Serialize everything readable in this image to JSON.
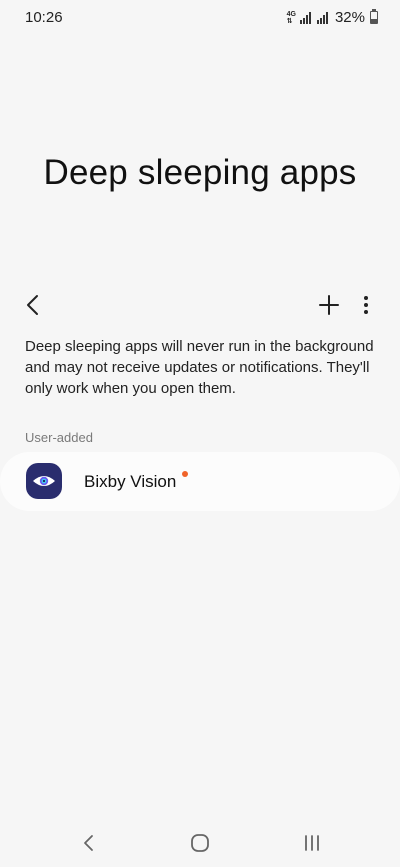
{
  "status_bar": {
    "time": "10:26",
    "network_top": "4G",
    "network_bottom": "⇅",
    "battery_percent": "32%",
    "battery_level": 0.32
  },
  "page": {
    "title": "Deep sleeping apps",
    "description": "Deep sleeping apps will never run in the background and may not receive updates or notifications. They'll only work when you open them."
  },
  "toolbar": {
    "back_icon": "chevron-left-icon",
    "add_icon": "plus-icon",
    "more_icon": "more-vertical-icon"
  },
  "section": {
    "header": "User-added"
  },
  "apps": [
    {
      "name": "Bixby Vision",
      "icon": "bixby-vision-icon",
      "icon_color": "#2a2d6e",
      "has_badge": true,
      "badge_color": "#f0632a"
    }
  ],
  "nav_bar": {
    "back_icon": "nav-back-icon",
    "home_icon": "nav-home-icon",
    "recents_icon": "nav-recents-icon"
  }
}
